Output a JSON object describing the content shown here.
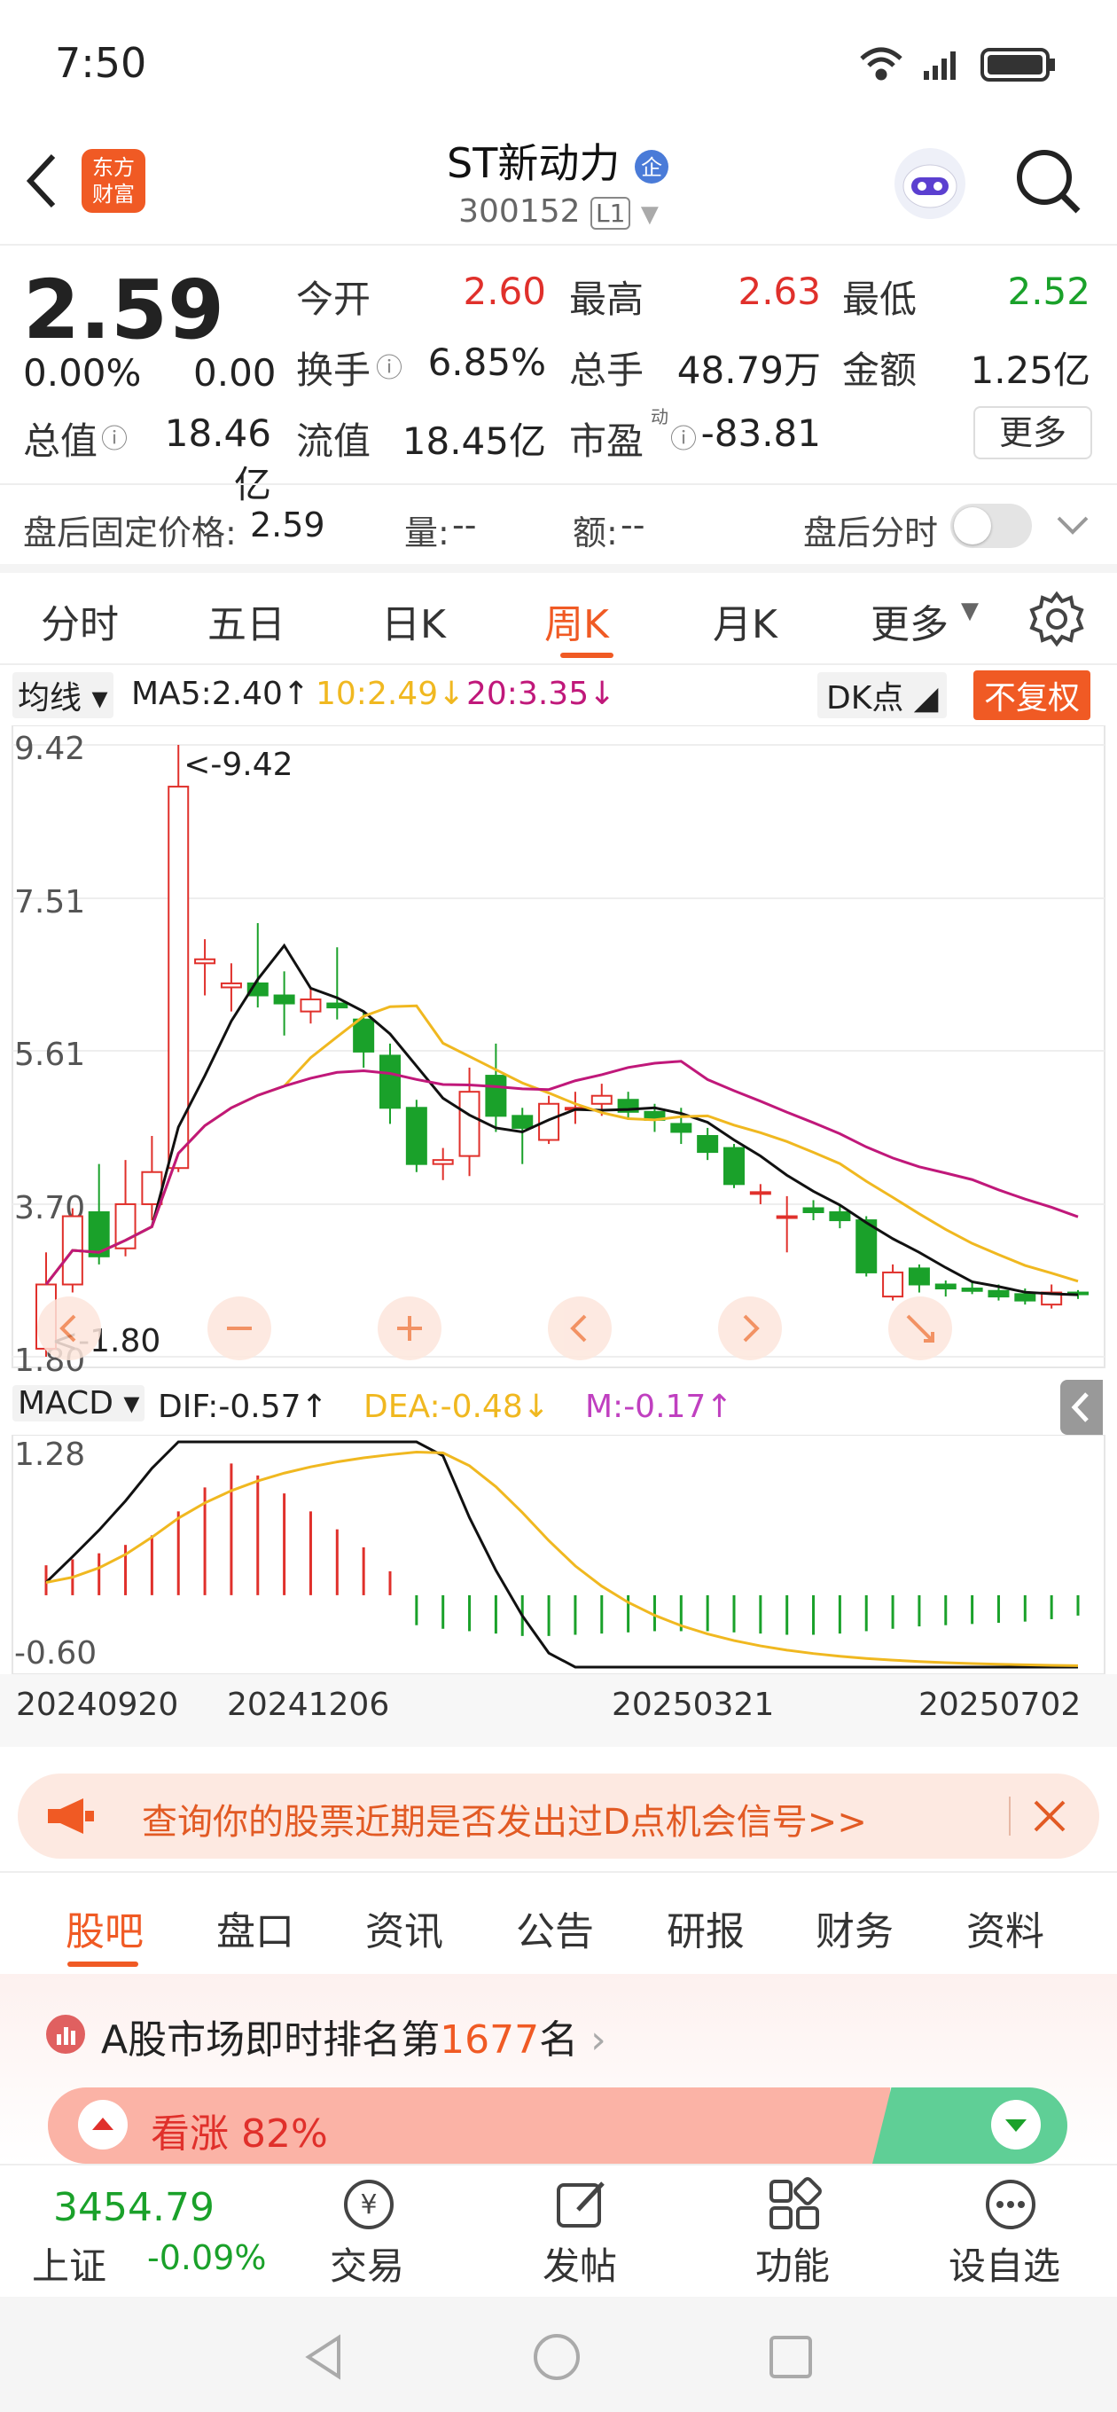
{
  "status": {
    "time": "7:50"
  },
  "header": {
    "title": "ST新动力",
    "code": "300152",
    "level": "L1",
    "logo_text": "东方\n财富"
  },
  "quote": {
    "price": "2.59",
    "change_pct": "0.00%",
    "change": "0.00",
    "open_label": "今开",
    "open": "2.60",
    "high_label": "最高",
    "high": "2.63",
    "low_label": "最低",
    "low": "2.52",
    "turnover_label": "换手",
    "turnover": "6.85%",
    "volume_label": "总手",
    "volume": "48.79万",
    "amount_label": "金额",
    "amount": "1.25亿",
    "mktcap_label": "总值",
    "mktcap": "18.46亿",
    "float_label": "流值",
    "float": "18.45亿",
    "pe_label": "市盈",
    "pe_sup": "动",
    "pe": "-83.81",
    "more": "更多"
  },
  "after_hours": {
    "price_label": "盘后固定价格:",
    "price": "2.59",
    "vol_label": "量:",
    "vol": "--",
    "amt_label": "额:",
    "amt": "--",
    "timeshare_label": "盘后分时"
  },
  "period_tabs": [
    "分时",
    "五日",
    "日K",
    "周K",
    "月K",
    "更多"
  ],
  "active_tab": "周K",
  "ma_legend": {
    "selector": "均线",
    "ma5": "MA5:2.40↑",
    "ma10": "10:2.49↓",
    "ma20": "20:3.35↓",
    "dk": "DK点",
    "adjust": "不复权"
  },
  "kline": {
    "axis_labels": [
      "9.42",
      "7.51",
      "5.61",
      "3.70",
      "1.80"
    ],
    "max_label": "<-9.42",
    "min_label": "<-1.80"
  },
  "macd_legend": {
    "selector": "MACD",
    "dif": "DIF:-0.57↑",
    "dea": "DEA:-0.48↓",
    "m": "M:-0.17↑"
  },
  "macd": {
    "axis_labels": [
      "1.28",
      "-0.60"
    ]
  },
  "dates": [
    "20240920",
    "20241206",
    "20250321",
    "20250702"
  ],
  "colors": {
    "up": "#e0302b",
    "down": "#1aa12a",
    "ma5": "#111111",
    "ma10": "#f0b820",
    "ma20": "#c0187a",
    "accent": "#f05a24"
  },
  "chart_data": {
    "type": "candlestick",
    "candles": [
      [
        1.9,
        2.7,
        3.1,
        1.8
      ],
      [
        2.7,
        3.55,
        3.65,
        2.6
      ],
      [
        3.6,
        3.05,
        4.2,
        2.95
      ],
      [
        3.15,
        3.7,
        4.25,
        3.05
      ],
      [
        3.7,
        4.1,
        4.55,
        3.5
      ],
      [
        4.15,
        8.9,
        9.42,
        4.1
      ],
      [
        6.7,
        6.75,
        7.0,
        6.3
      ],
      [
        6.4,
        6.45,
        6.7,
        6.1
      ],
      [
        6.45,
        6.3,
        7.2,
        6.15
      ],
      [
        6.3,
        6.2,
        6.6,
        5.8
      ],
      [
        6.1,
        6.25,
        6.4,
        5.95
      ],
      [
        6.2,
        6.15,
        6.9,
        6.0
      ],
      [
        6.0,
        5.6,
        6.1,
        5.4
      ],
      [
        5.55,
        4.9,
        5.7,
        4.7
      ],
      [
        4.9,
        4.2,
        5.0,
        4.1
      ],
      [
        4.2,
        4.25,
        4.4,
        4.0
      ],
      [
        4.3,
        5.1,
        5.4,
        4.05
      ],
      [
        5.3,
        4.8,
        5.7,
        4.6
      ],
      [
        4.8,
        4.65,
        4.9,
        4.2
      ],
      [
        4.5,
        4.95,
        5.05,
        4.45
      ],
      [
        4.9,
        4.9,
        5.1,
        4.7
      ],
      [
        4.95,
        5.05,
        5.2,
        4.8
      ],
      [
        5.0,
        4.85,
        5.1,
        4.75
      ],
      [
        4.85,
        4.75,
        4.95,
        4.6
      ],
      [
        4.7,
        4.6,
        4.9,
        4.45
      ],
      [
        4.55,
        4.35,
        4.65,
        4.25
      ],
      [
        4.4,
        3.95,
        4.45,
        3.9
      ],
      [
        3.85,
        3.85,
        3.95,
        3.7
      ],
      [
        3.55,
        3.55,
        3.8,
        3.1
      ],
      [
        3.65,
        3.6,
        3.75,
        3.5
      ],
      [
        3.6,
        3.5,
        3.7,
        3.4
      ],
      [
        3.5,
        2.85,
        3.55,
        2.8
      ],
      [
        2.55,
        2.85,
        2.95,
        2.5
      ],
      [
        2.9,
        2.7,
        2.95,
        2.6
      ],
      [
        2.7,
        2.65,
        2.75,
        2.55
      ],
      [
        2.65,
        2.62,
        2.75,
        2.58
      ],
      [
        2.62,
        2.55,
        2.7,
        2.5
      ],
      [
        2.58,
        2.5,
        2.65,
        2.45
      ],
      [
        2.45,
        2.6,
        2.7,
        2.4
      ],
      [
        2.6,
        2.59,
        2.63,
        2.52
      ]
    ],
    "macd_hist": [
      0.25,
      0.3,
      0.35,
      0.42,
      0.5,
      0.7,
      0.9,
      1.1,
      1.0,
      0.85,
      0.7,
      0.55,
      0.4,
      0.2,
      -0.25,
      -0.28,
      -0.3,
      -0.32,
      -0.34,
      -0.34,
      -0.33,
      -0.32,
      -0.31,
      -0.3,
      -0.3,
      -0.3,
      -0.31,
      -0.32,
      -0.33,
      -0.33,
      -0.32,
      -0.3,
      -0.28,
      -0.26,
      -0.25,
      -0.24,
      -0.23,
      -0.22,
      -0.2,
      -0.17
    ],
    "y_range": [
      1.8,
      9.42
    ],
    "macd_range": [
      -0.6,
      1.28
    ]
  },
  "banner": {
    "text": "查询你的股票近期是否发出过D点机会信号>>"
  },
  "bottom_tabs": [
    "股吧",
    "盘口",
    "资讯",
    "公告",
    "研报",
    "财务",
    "资料"
  ],
  "ranking": {
    "prefix": "A股市场即时排名第",
    "rank": "1677",
    "suffix": "名"
  },
  "sentiment": {
    "label": "看涨 82%"
  },
  "index": {
    "value": "3454.79",
    "name": "上证",
    "change": "-0.09%"
  },
  "dock": [
    "交易",
    "发帖",
    "功能",
    "设自选"
  ]
}
